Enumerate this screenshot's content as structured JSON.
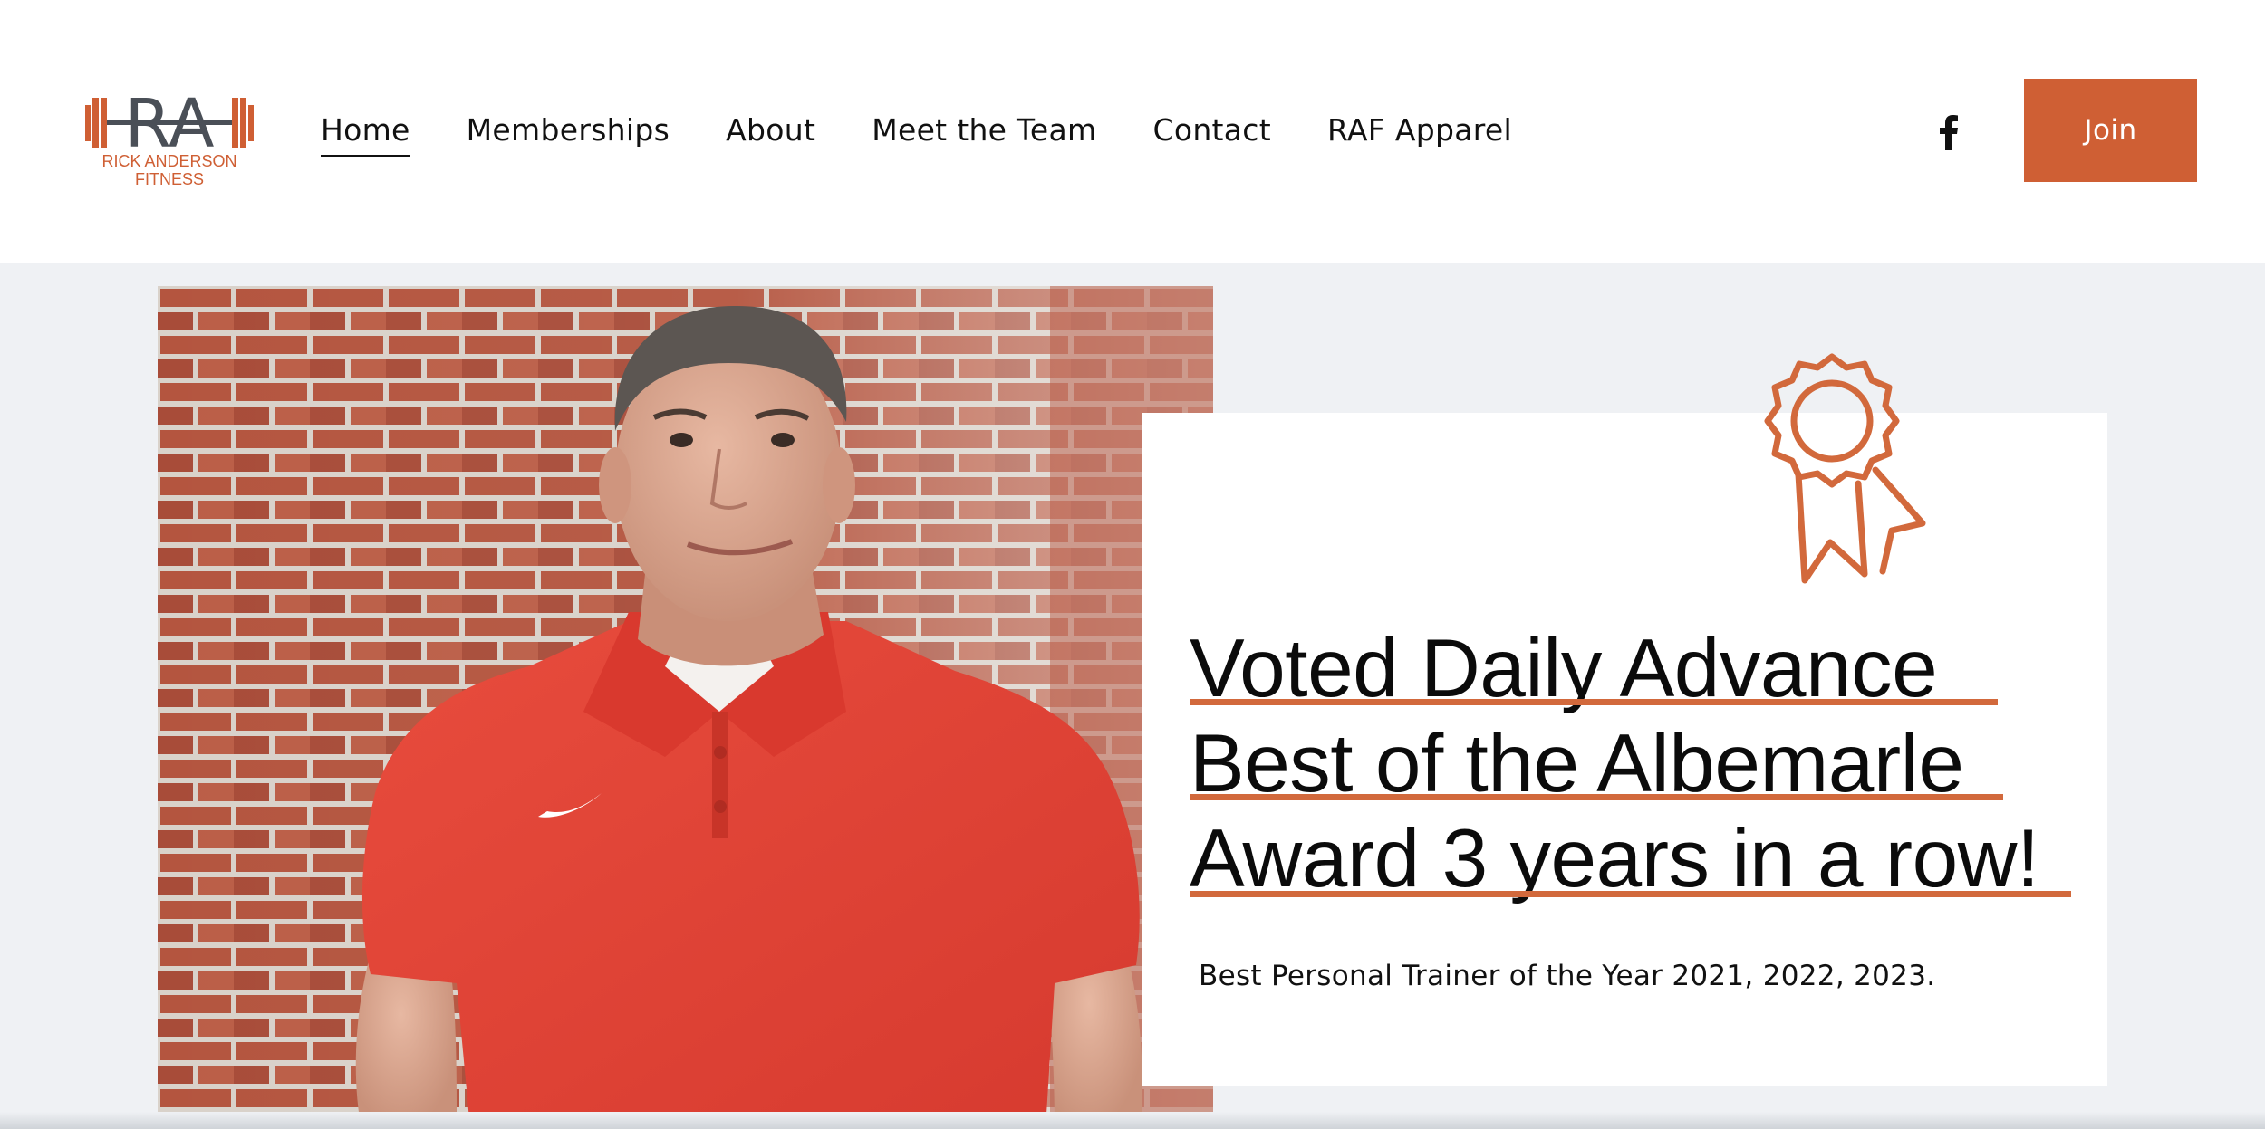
{
  "brand": {
    "initials": "RA",
    "name_line1": "RICK ANDERSON",
    "name_line2": "FITNESS",
    "accent_color": "#cf5f34"
  },
  "nav": {
    "items": [
      {
        "label": "Home",
        "active": true
      },
      {
        "label": "Memberships",
        "active": false
      },
      {
        "label": "About",
        "active": false
      },
      {
        "label": "Meet the Team",
        "active": false
      },
      {
        "label": "Contact",
        "active": false
      },
      {
        "label": "RAF Apparel",
        "active": false
      }
    ]
  },
  "social": {
    "facebook_icon": "facebook-icon",
    "facebook_glyph": "f"
  },
  "header": {
    "join_label": "Join"
  },
  "hero": {
    "photo": "portrait-photo",
    "award_icon": "award-ribbon-icon",
    "headline_lines": [
      "Voted Daily Advance",
      "Best of the Albemarle",
      "Award 3 years in a row!"
    ],
    "subtext": "Best Personal Trainer of the Year 2021, 2022, 2023."
  }
}
